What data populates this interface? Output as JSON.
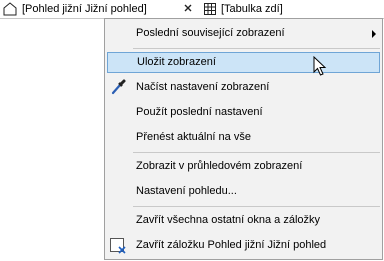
{
  "tabs": [
    {
      "label": "[Pohled jižní Jižní pohled]",
      "icon": "elevation-view-icon"
    },
    {
      "label": "[Tabulka zdí]",
      "icon": "table-grid-icon"
    }
  ],
  "context_menu": {
    "items": [
      {
        "label": "Poslední související zobrazení",
        "has_submenu": true
      },
      {
        "label": "Uložit zobrazení",
        "highlighted": true
      },
      {
        "label": "Načíst nastavení zobrazení",
        "icon": "eyedropper-icon"
      },
      {
        "label": "Použít poslední nastavení"
      },
      {
        "label": "Přenést aktuální na vše"
      },
      {
        "label": "Zobrazit v průhledovém zobrazení"
      },
      {
        "label": "Nastavení pohledu..."
      },
      {
        "label": "Zavřít všechna ostatní okna a záložky"
      },
      {
        "label": "Zavřít záložku Pohled jižní Jižní pohled",
        "icon": "close-tab-icon"
      }
    ]
  },
  "colors": {
    "highlight_bg": "#cce4f7",
    "highlight_border": "#6fa5d6",
    "menu_bg": "#f2f2f2",
    "eyedropper": "#2b5fb4",
    "close_tab_icon": "#1f5fbf"
  }
}
